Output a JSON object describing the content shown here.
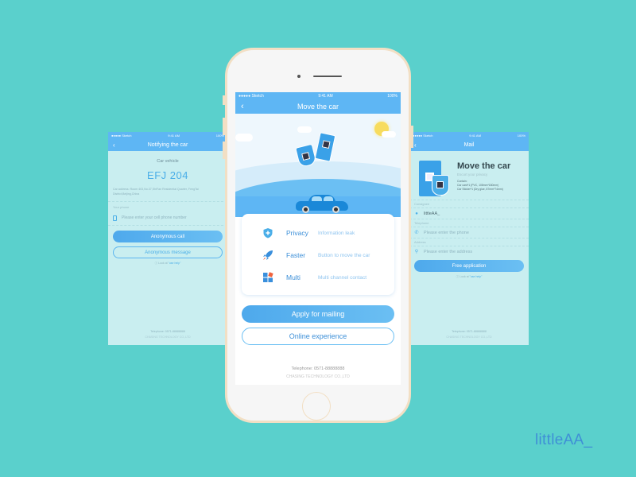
{
  "status_bar": {
    "carrier": "●●●●● Sketch",
    "time": "9:41 AM",
    "battery": "100%"
  },
  "left_screen": {
    "title": "Notifying the car",
    "back_icon": "chevron-left-icon",
    "car_vehicle_label": "Car vehicle",
    "plate": "EFJ 204",
    "car_address": "Car address:  Room 403,No.37,ShiFan Residential Quarter, FengTai District,Beijing,China",
    "phone_label": "Your phone",
    "phone_placeholder": "Please enter your cell phone number",
    "anonymous_call": "Anonymous call",
    "anonymous_message": "Anonymous message",
    "help_prefix": "ⓘ Look at ",
    "help_link": "\"use help\"",
    "telephone": "Telephone:  0571-88888888",
    "company": "CHASING TECHNOLOGY CO.,LTD"
  },
  "main_screen": {
    "title": "Move the car",
    "back_icon": "chevron-left-icon",
    "features": [
      {
        "icon": "shield-plus-icon",
        "name": "Privacy",
        "desc": "Information leak"
      },
      {
        "icon": "rocket-icon",
        "name": "Faster",
        "desc": "Button to move the car"
      },
      {
        "icon": "multi-window-icon",
        "name": "Multi",
        "desc": "Multi channel contact"
      }
    ],
    "apply_button": "Apply for mailing",
    "online_button": "Online experience",
    "telephone": "Telephone:  0571-88888888",
    "company": "CHASING TECHNOLOGY CO.,LTD"
  },
  "right_screen": {
    "title": "Mail",
    "back_icon": "chevron-left-icon",
    "hero_title": "Move the car",
    "hero_subtitle": "Escort your privacy",
    "contain_label": "Contain:",
    "contain_item1": "Car card*1  (PVC,  108mm*180mm)",
    "contain_item2": "Car Sticker*1  (Dry glue,  87mm*74mm)",
    "consignee_label": "Consignee",
    "consignee_value": "littleAA_",
    "telephone_label": "Telephone",
    "telephone_placeholder": "Please enter the phone",
    "address_label": "Address",
    "address_placeholder": "Please enter the address",
    "free_button": "Free application",
    "help_prefix": "ⓘ Look at ",
    "help_link": "\"use help\"",
    "telephone": "Telephone:  0571-88888888",
    "company": "CHASING TECHNOLOGY CO.,LTD"
  },
  "signature": "littleAA_",
  "colors": {
    "background": "#5ad0cc",
    "primary": "#5eb6f4",
    "accent_text": "#3c8fd8",
    "phone_frame": "#f2dfc4"
  }
}
